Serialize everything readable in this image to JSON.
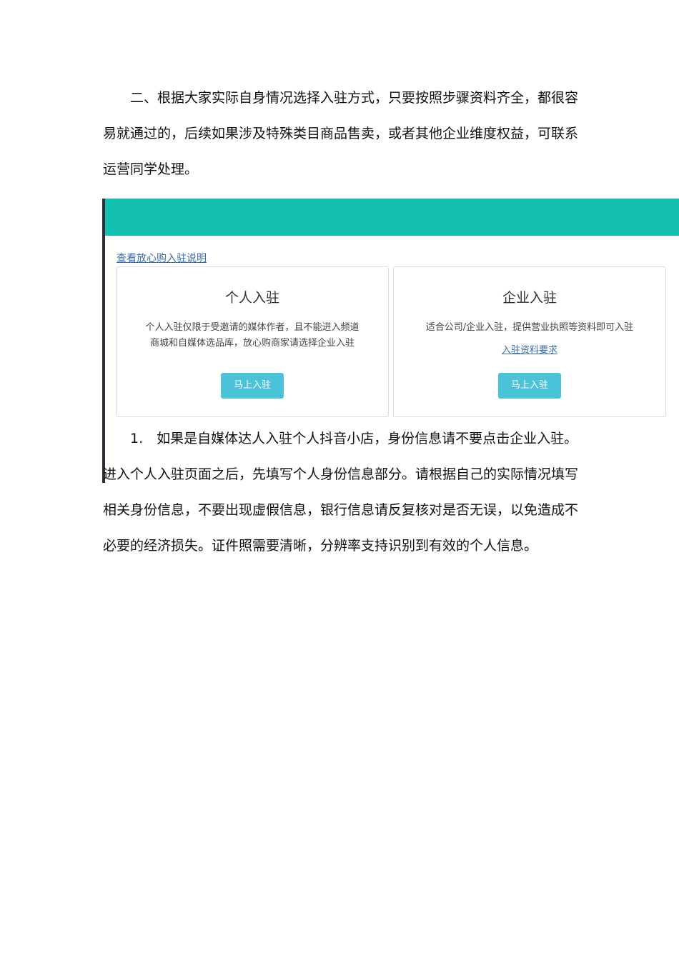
{
  "paragraph1": {
    "lines": [
      "　　二、根据大家实际自身情况选择入驻方式，只要按照步骤资料齐全，都很容",
      "易就通过的，后续如果涉及特殊类目商品售卖，或者其他企业维度权益，可联系",
      "运营同学处理。"
    ]
  },
  "screenshot": {
    "header_color": "#13bfae",
    "info_link": "查看放心购入驻说明",
    "personal": {
      "title": "个人入驻",
      "desc_lines": [
        "个人入驻仅限于受邀请的媒体作者，且不能进入频道",
        "商城和自媒体选品库，放心购商家请选择企业入驻"
      ],
      "button": "马上入驻"
    },
    "company": {
      "title": "企业入驻",
      "desc_lines": [
        "适合公司/企业入驻，提供营业执照等资料即可入驻"
      ],
      "link": "入驻资料要求",
      "button": "马上入驻"
    },
    "button_color": "#4ac3d9"
  },
  "paragraph2": {
    "lines": [
      "　　1.　如果是自媒体达人入驻个人抖音小店，身份信息请不要点击企业入驻。",
      "进入个人入驻页面之后，先填写个人身份信息部分。请根据自己的实际情况填写",
      "相关身份信息，不要出现虚假信息，银行信息请反复核对是否无误，以免造成不",
      "必要的经济损失。证件照需要清晰，分辨率支持识别到有效的个人信息。"
    ]
  }
}
